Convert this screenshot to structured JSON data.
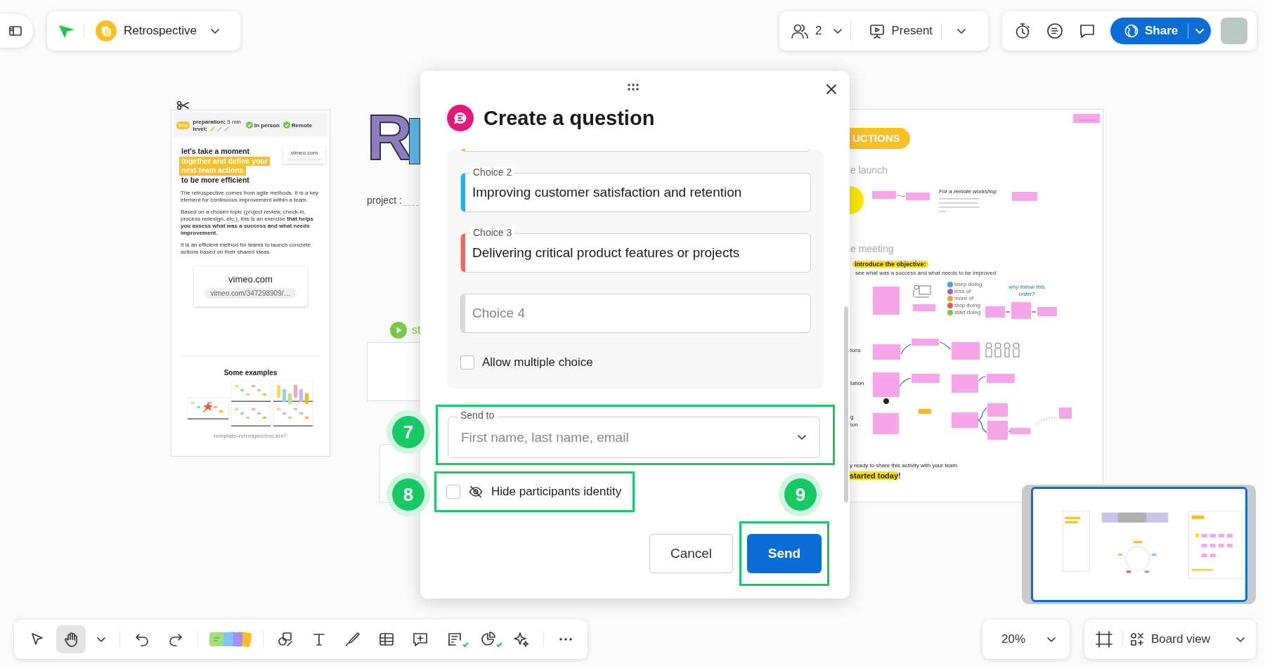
{
  "board_menu": {
    "title": "Retrospective"
  },
  "collaborators": {
    "count": "2"
  },
  "present": {
    "label": "Present"
  },
  "share": {
    "label": "Share"
  },
  "canvas": {
    "info_card": {
      "badge": "Info",
      "preparation": "**preparation:** 5 min",
      "level_label": "level:",
      "modes": [
        "In person",
        "Remote"
      ],
      "heading": [
        {
          "text": "let's take a moment",
          "highlighted": false
        },
        {
          "text": "together and define your",
          "highlighted": true
        },
        {
          "text": "next team actions",
          "highlighted": true
        },
        {
          "text": "to be more efficient",
          "highlighted": false
        }
      ],
      "small_link": {
        "domain": "vimeo.com"
      },
      "paragraphs": [
        "The retrospective comes from agile methods. It is a key element for continuous improvement within a team.",
        "Based on a chosen topic (project review, check-in, process redesign, etc.), this is an exercise **that helps you assess what was a success and what needs improvement.**",
        "It is an efficient method for teams to launch concrete actions based on their shared ideas."
      ],
      "link_card": {
        "domain": "vimeo.com",
        "url": "vimeo.com/347298909/…"
      },
      "examples_title": "Some examples",
      "footer": "template-retrospective.klx©"
    },
    "logo": "R",
    "project_label": "project :",
    "start_label": "st",
    "instructions": {
      "banner": "UCTIONS",
      "sections": [
        "e launch",
        "e meeting"
      ],
      "remote_note": "For a remote workshop",
      "objective": "introduce the objective:",
      "objective_note": "see what was a success and what needs to be improved",
      "legend": [
        {
          "text": "keep doing",
          "color": "#3ba7e6"
        },
        {
          "text": "less of",
          "color": "#8e6fd1"
        },
        {
          "text": "more of",
          "color": "#f5a623"
        },
        {
          "text": "stop doing",
          "color": "#ef5350"
        },
        {
          "text": "start doing",
          "color": "#7ac943"
        }
      ],
      "order_note": "why follow this order?",
      "step_labels": [
        "ions",
        "tation",
        "g",
        "ion"
      ],
      "closing": "y ready to share this activity with your team.",
      "cta": {
        "highlight": "started today",
        "rest": "!"
      }
    }
  },
  "dialog": {
    "title": "Create a question",
    "choices": [
      {
        "kind": "cut",
        "color": "#f5b82e"
      },
      {
        "kind": "filled",
        "label": "Choice 2",
        "value": "Improving customer satisfaction and retention",
        "color": "#1fb0ea"
      },
      {
        "kind": "filled",
        "label": "Choice 3",
        "value": "Delivering critical product features or projects",
        "color": "#f26363"
      },
      {
        "kind": "empty",
        "placeholder": "Choice 4",
        "color": "#d9d9d9"
      }
    ],
    "allow_multiple": {
      "label": "Allow multiple choice",
      "checked": false
    },
    "send_to": {
      "label": "Send to",
      "placeholder": "First name, last name, email"
    },
    "hide_identity": {
      "label": "Hide participants identity",
      "checked": false
    },
    "buttons": [
      {
        "label": "Cancel",
        "kind": "secondary"
      },
      {
        "label": "Send",
        "kind": "primary"
      }
    ]
  },
  "annotations": [
    {
      "number": "7"
    },
    {
      "number": "8"
    },
    {
      "number": "9"
    }
  ],
  "toolbar": {
    "tool_groups": [
      [
        {
          "kind": "select",
          "selected": false
        },
        {
          "kind": "hand",
          "selected": true
        },
        {
          "kind": "more_tools",
          "selected": false
        }
      ],
      [
        {
          "kind": "undo",
          "selected": false
        },
        {
          "kind": "redo",
          "selected": false
        }
      ],
      [
        {
          "kind": "sticky",
          "selected": false
        }
      ],
      [
        {
          "kind": "shapes",
          "selected": false
        },
        {
          "kind": "text",
          "selected": false
        },
        {
          "kind": "pen",
          "selected": false
        },
        {
          "kind": "table",
          "selected": false
        },
        {
          "kind": "comment",
          "selected": false
        },
        {
          "kind": "checklist",
          "selected": false
        },
        {
          "kind": "poll",
          "selected": false
        },
        {
          "kind": "ai",
          "selected": false
        }
      ],
      [
        {
          "kind": "more",
          "selected": false
        }
      ]
    ]
  },
  "zoom": {
    "value": "20%"
  },
  "view": {
    "label": "Board view"
  }
}
